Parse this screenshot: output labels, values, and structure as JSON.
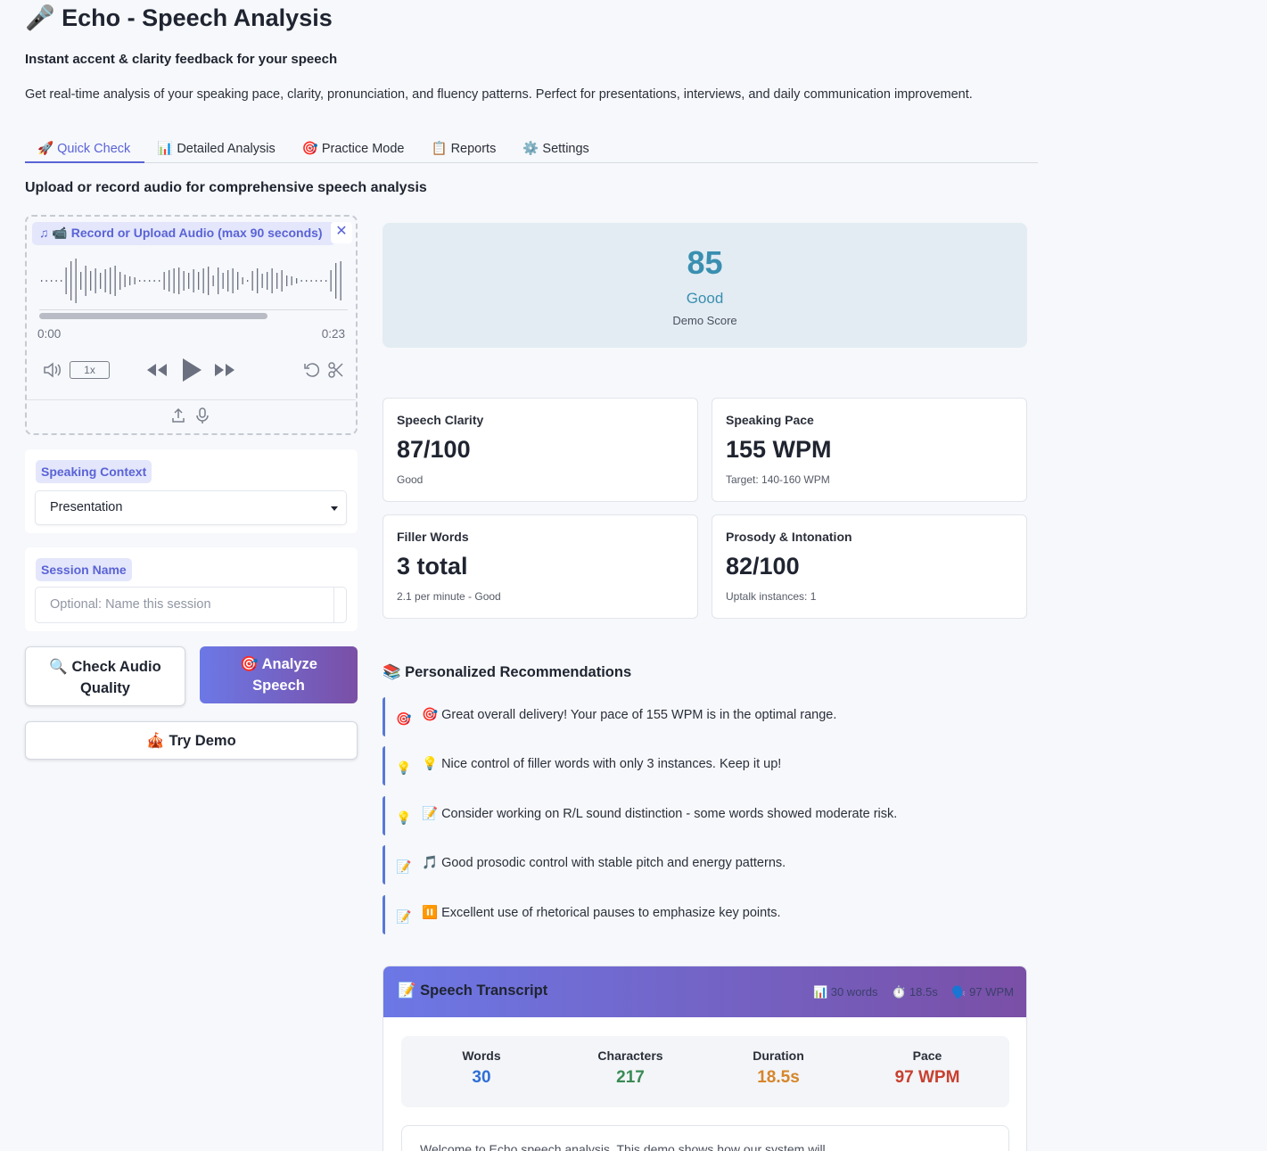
{
  "app": {
    "title": "🎤 Echo - Speech Analysis",
    "subtitle": "Instant accent & clarity feedback for your speech",
    "description": "Get real-time analysis of your speaking pace, clarity, pronunciation, and fluency patterns. Perfect for presentations, interviews, and daily communication improvement."
  },
  "tabs": [
    {
      "icon": "🚀",
      "label": "Quick Check",
      "active": true
    },
    {
      "icon": "📊",
      "label": "Detailed Analysis"
    },
    {
      "icon": "🎯",
      "label": "Practice Mode"
    },
    {
      "icon": "📋",
      "label": "Reports"
    },
    {
      "icon": "⚙️",
      "label": "Settings"
    }
  ],
  "section_heading": "Upload or record audio for comprehensive speech analysis",
  "audio": {
    "label": "📹 Record or Upload Audio (max 90 seconds)",
    "time_start": "0:00",
    "time_end": "0:23",
    "speed": "1x",
    "progress": 0.74
  },
  "context": {
    "label": "Speaking Context",
    "value": "Presentation"
  },
  "session": {
    "label": "Session Name",
    "placeholder": "Optional: Name this session"
  },
  "buttons": {
    "check_quality": "🔍 Check Audio Quality",
    "analyze": "🎯 Analyze Speech",
    "demo": "🎪 Try Demo"
  },
  "score": {
    "value": "85",
    "label": "Good",
    "sub": "Demo Score"
  },
  "metrics": [
    {
      "title": "Speech Clarity",
      "value": "87/100",
      "sub": "Good"
    },
    {
      "title": "Speaking Pace",
      "value": "155 WPM",
      "sub": "Target: 140-160 WPM"
    },
    {
      "title": "Filler Words",
      "value": "3 total",
      "sub": "2.1 per minute - Good"
    },
    {
      "title": "Prosody & Intonation",
      "value": "82/100",
      "sub": "Uptalk instances: 1"
    }
  ],
  "recommendations": {
    "heading": "📚 Personalized Recommendations",
    "items": [
      {
        "icon": "🎯",
        "text": "🎯 Great overall delivery! Your pace of 155 WPM is in the optimal range."
      },
      {
        "icon": "💡",
        "text": "💡 Nice control of filler words with only 3 instances. Keep it up!"
      },
      {
        "icon": "💡",
        "text": "📝 Consider working on R/L sound distinction - some words showed moderate risk."
      },
      {
        "icon": "📝",
        "text": "🎵 Good prosodic control with stable pitch and energy patterns."
      },
      {
        "icon": "📝",
        "text": "⏸️ Excellent use of rhetorical pauses to emphasize key points."
      }
    ]
  },
  "transcript": {
    "title": "📝 Speech Transcript",
    "header_words": "📊 30 words",
    "header_duration": "⏱️ 18.5s",
    "header_pace": "🗣️ 97 WPM",
    "stats": [
      {
        "label": "Words",
        "value": "30",
        "color": "#2f6fd6"
      },
      {
        "label": "Characters",
        "value": "217",
        "color": "#3a8a55"
      },
      {
        "label": "Duration",
        "value": "18.5s",
        "color": "#d6852a"
      },
      {
        "label": "Pace",
        "value": "97 WPM",
        "color": "#c8402f"
      }
    ],
    "text": "Welcome to Echo speech analysis. This demo shows how our system will..."
  },
  "colors": {
    "accent": "#5a63d6",
    "score": "#3a8fb0"
  }
}
